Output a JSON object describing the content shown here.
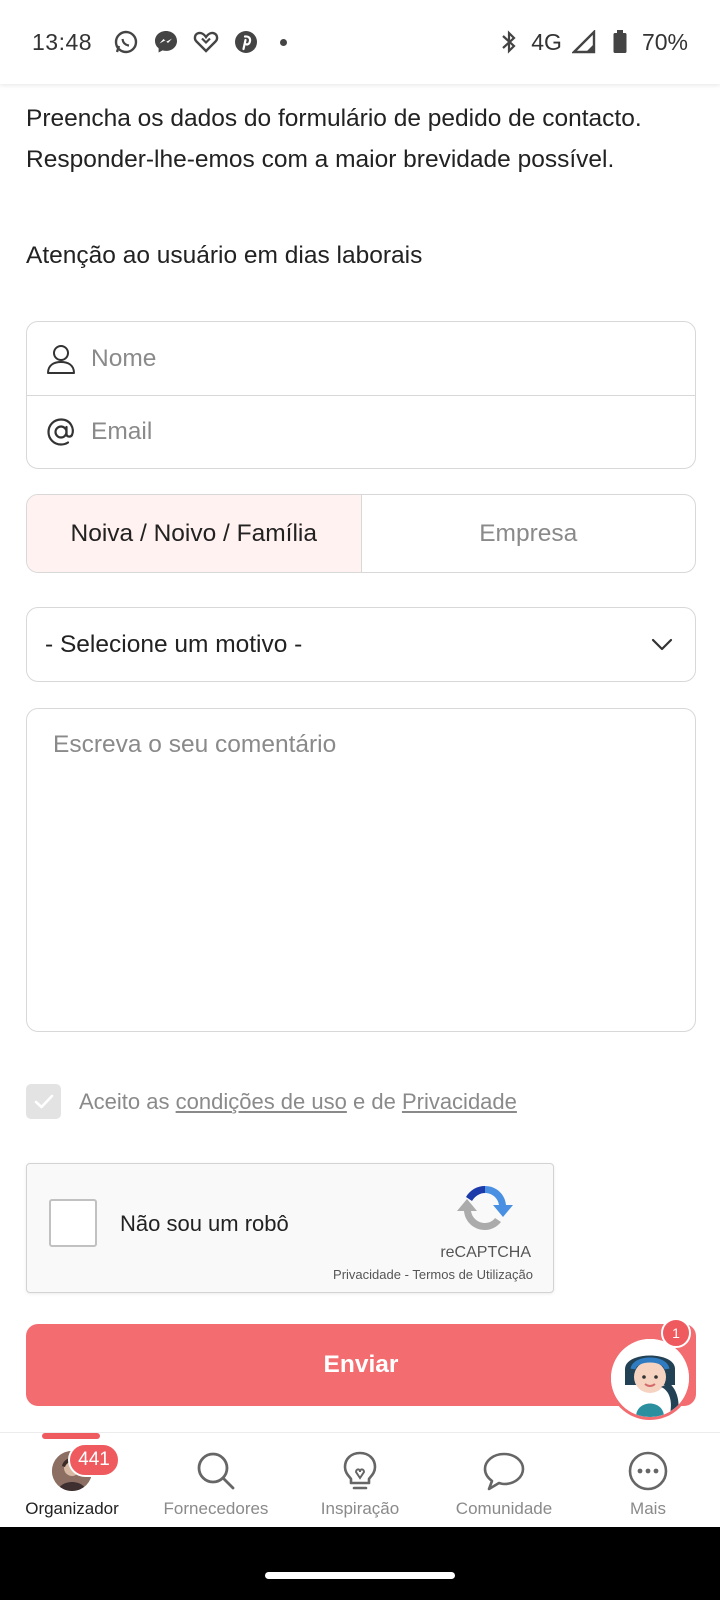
{
  "status_bar": {
    "time": "13:48",
    "notification_icons": [
      "whatsapp-icon",
      "messenger-icon",
      "heart-icon",
      "pinterest-icon"
    ],
    "network": "4G",
    "battery": "70%"
  },
  "intro": {
    "text": "Preencha os dados do formulário de pedido de contacto. Responder-lhe-emos com a maior brevidade possível.",
    "attention": "Atenção ao usuário em dias laborais"
  },
  "form": {
    "name_placeholder": "Nome",
    "email_placeholder": "Email",
    "segments": [
      "Noiva / Noivo / Família",
      "Empresa"
    ],
    "selected_segment": "Noiva / Noivo / Família",
    "reason_select": "- Selecione um motivo -",
    "comment_placeholder": "Escreva o seu comentário",
    "terms": {
      "prefix": "Aceito as",
      "link_terms": "condições de uso",
      "middle": "e de",
      "link_privacy": "Privacidade",
      "checked": true
    },
    "recaptcha": {
      "label": "Não sou um robô",
      "brand": "reCAPTCHA",
      "privacy": "Privacidade",
      "separator": "-",
      "terms": "Termos de Utilização"
    },
    "submit_label": "Enviar"
  },
  "assistant": {
    "badge": "1"
  },
  "bottom_nav": {
    "items": [
      {
        "label": "Organizador",
        "icon": "avatar",
        "badge": "441",
        "active": true
      },
      {
        "label": "Fornecedores",
        "icon": "search-icon"
      },
      {
        "label": "Inspiração",
        "icon": "lightbulb-icon"
      },
      {
        "label": "Comunidade",
        "icon": "chat-bubble-icon"
      },
      {
        "label": "Mais",
        "icon": "more-icon"
      }
    ]
  },
  "colors": {
    "accent": "#f36c70",
    "badge": "#ef5a5f",
    "segment_active_bg": "#fff2f0",
    "placeholder": "#8a8a8a",
    "border": "#d8d8d8"
  }
}
